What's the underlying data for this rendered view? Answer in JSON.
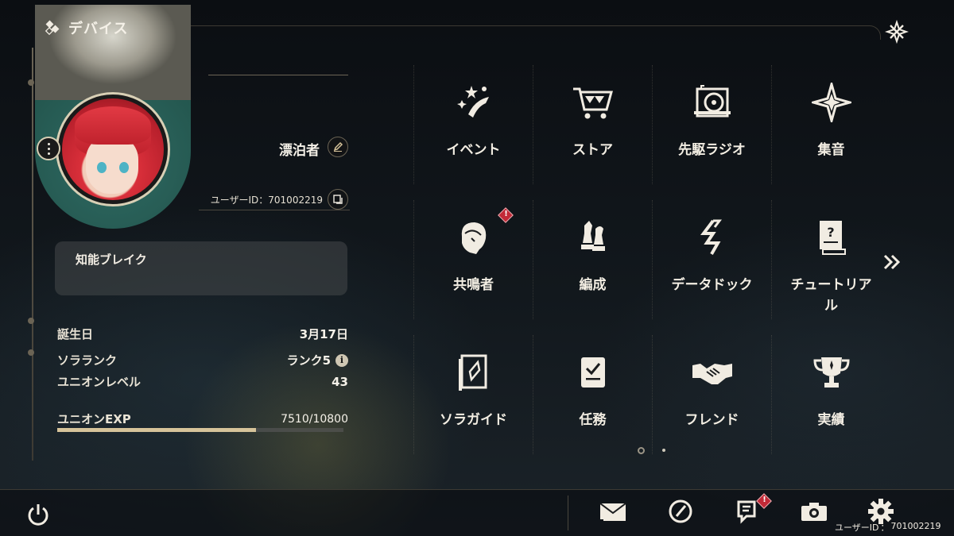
{
  "header": {
    "title": "デバイス",
    "icon": "diamond-icon"
  },
  "profile": {
    "username": "漂泊者",
    "user_id_label": "ユーザーID",
    "user_id_separator": "：",
    "user_id": "701002219",
    "bio": "知能ブレイク"
  },
  "stats": {
    "birthday": {
      "label": "誕生日",
      "value": "3月17日"
    },
    "sola_rank": {
      "label": "ソラランク",
      "value": "ランク5"
    },
    "union_level": {
      "label": "ユニオンレベル",
      "value": "43"
    },
    "union_exp": {
      "label": "ユニオンEXP",
      "value": "7510/10800",
      "current": 7510,
      "max": 10800
    }
  },
  "menu": [
    {
      "label": "イベント",
      "icon": "event-stars-icon",
      "badge": false
    },
    {
      "label": "ストア",
      "icon": "cart-icon",
      "badge": false
    },
    {
      "label": "先駆ラジオ",
      "icon": "radio-icon",
      "badge": false
    },
    {
      "label": "集音",
      "icon": "compass-star-icon",
      "badge": false
    },
    {
      "label": "共鳴者",
      "icon": "resonator-icon",
      "badge": true
    },
    {
      "label": "編成",
      "icon": "chess-pieces-icon",
      "badge": false
    },
    {
      "label": "データドック",
      "icon": "data-dock-icon",
      "badge": false
    },
    {
      "label": "チュートリアル",
      "icon": "tutorial-book-icon",
      "badge": false
    },
    {
      "label": "ソラガイド",
      "icon": "guide-book-icon",
      "badge": false
    },
    {
      "label": "任務",
      "icon": "quest-clipboard-icon",
      "badge": false
    },
    {
      "label": "フレンド",
      "icon": "handshake-icon",
      "badge": false
    },
    {
      "label": "実績",
      "icon": "trophy-icon",
      "badge": false
    }
  ],
  "pagination": {
    "current": 1,
    "total": 2
  },
  "bottom_bar": {
    "icons": [
      "mail-icon",
      "clock-icon",
      "notice-icon",
      "camera-icon",
      "settings-gear-icon"
    ],
    "notice_badge": true,
    "user_id_label": "ユーザーID",
    "user_id_separator": "：",
    "user_id": "701002219"
  },
  "colors": {
    "accent_gold": "#d6c39a",
    "badge_red": "#c22a37",
    "text": "#f1ece2"
  }
}
